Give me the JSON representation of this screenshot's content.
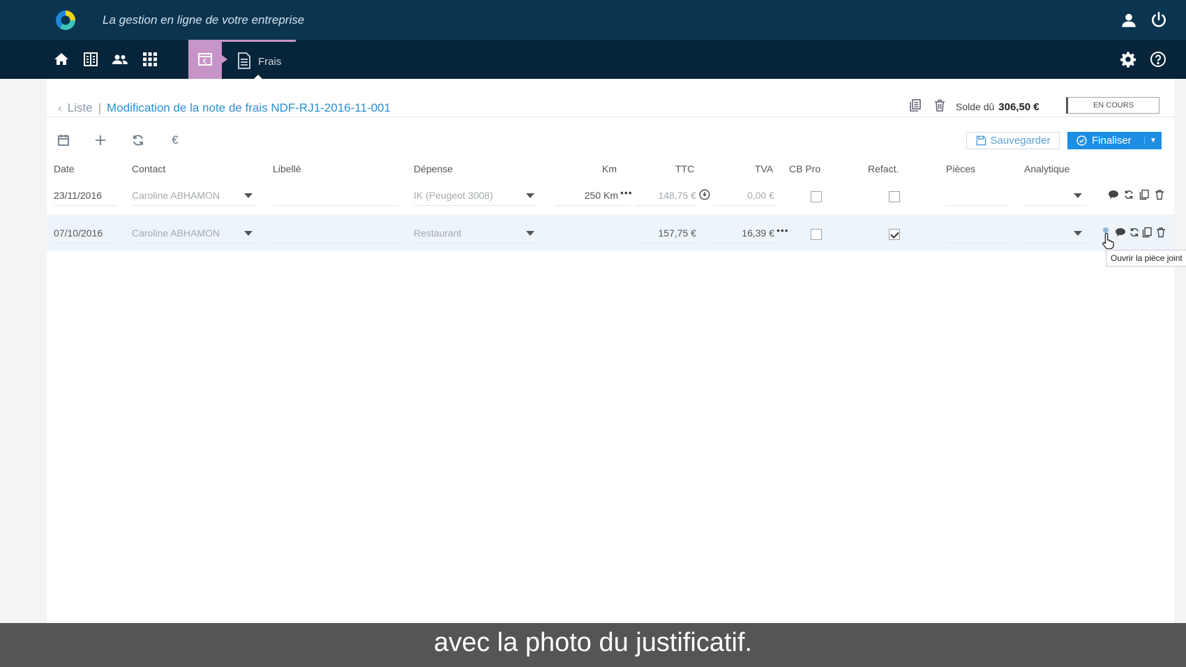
{
  "header": {
    "tagline": "La gestion en ligne de votre entreprise"
  },
  "nav": {
    "icons": [
      "home-icon",
      "ledger-icon",
      "users-icon",
      "apps-grid-icon"
    ],
    "module_icon": "expense-note-icon",
    "tab_label": "Frais"
  },
  "breadcrumb": {
    "back": "Liste",
    "title": "Modification de la note de frais NDF-RJ1-2016-11-001"
  },
  "summary": {
    "solde_label": "Solde dû",
    "solde_value": "306,50 €",
    "status": "EN COURS"
  },
  "toolbar": {
    "euro": "€",
    "save_label": "Sauvegarder",
    "finalize_label": "Finaliser"
  },
  "table": {
    "headers": {
      "date": "Date",
      "contact": "Contact",
      "libelle": "Libellé",
      "depense": "Dépense",
      "km": "Km",
      "ttc": "TTC",
      "tva": "TVA",
      "cbpro": "CB Pro",
      "refact": "Refact.",
      "pieces": "Pièces",
      "analytique": "Analytique"
    },
    "rows": [
      {
        "date": "23/11/2016",
        "contact": "Caroline ABHAMON",
        "libelle": "",
        "depense": "IK (Peugeot 3008)",
        "km": "250 Km",
        "ttc": "148,75 €",
        "tva": "0,00 €",
        "cbpro": false,
        "refact": false
      },
      {
        "date": "07/10/2016",
        "contact": "Caroline ABHAMON",
        "libelle": "",
        "depense": "Restaurant",
        "km": "",
        "ttc": "157,75 €",
        "tva": "16,39 €",
        "cbpro": false,
        "refact": true
      }
    ]
  },
  "tooltip": "Ouvrir la pièce joint",
  "subtitle": "avec la photo du justificatif."
}
